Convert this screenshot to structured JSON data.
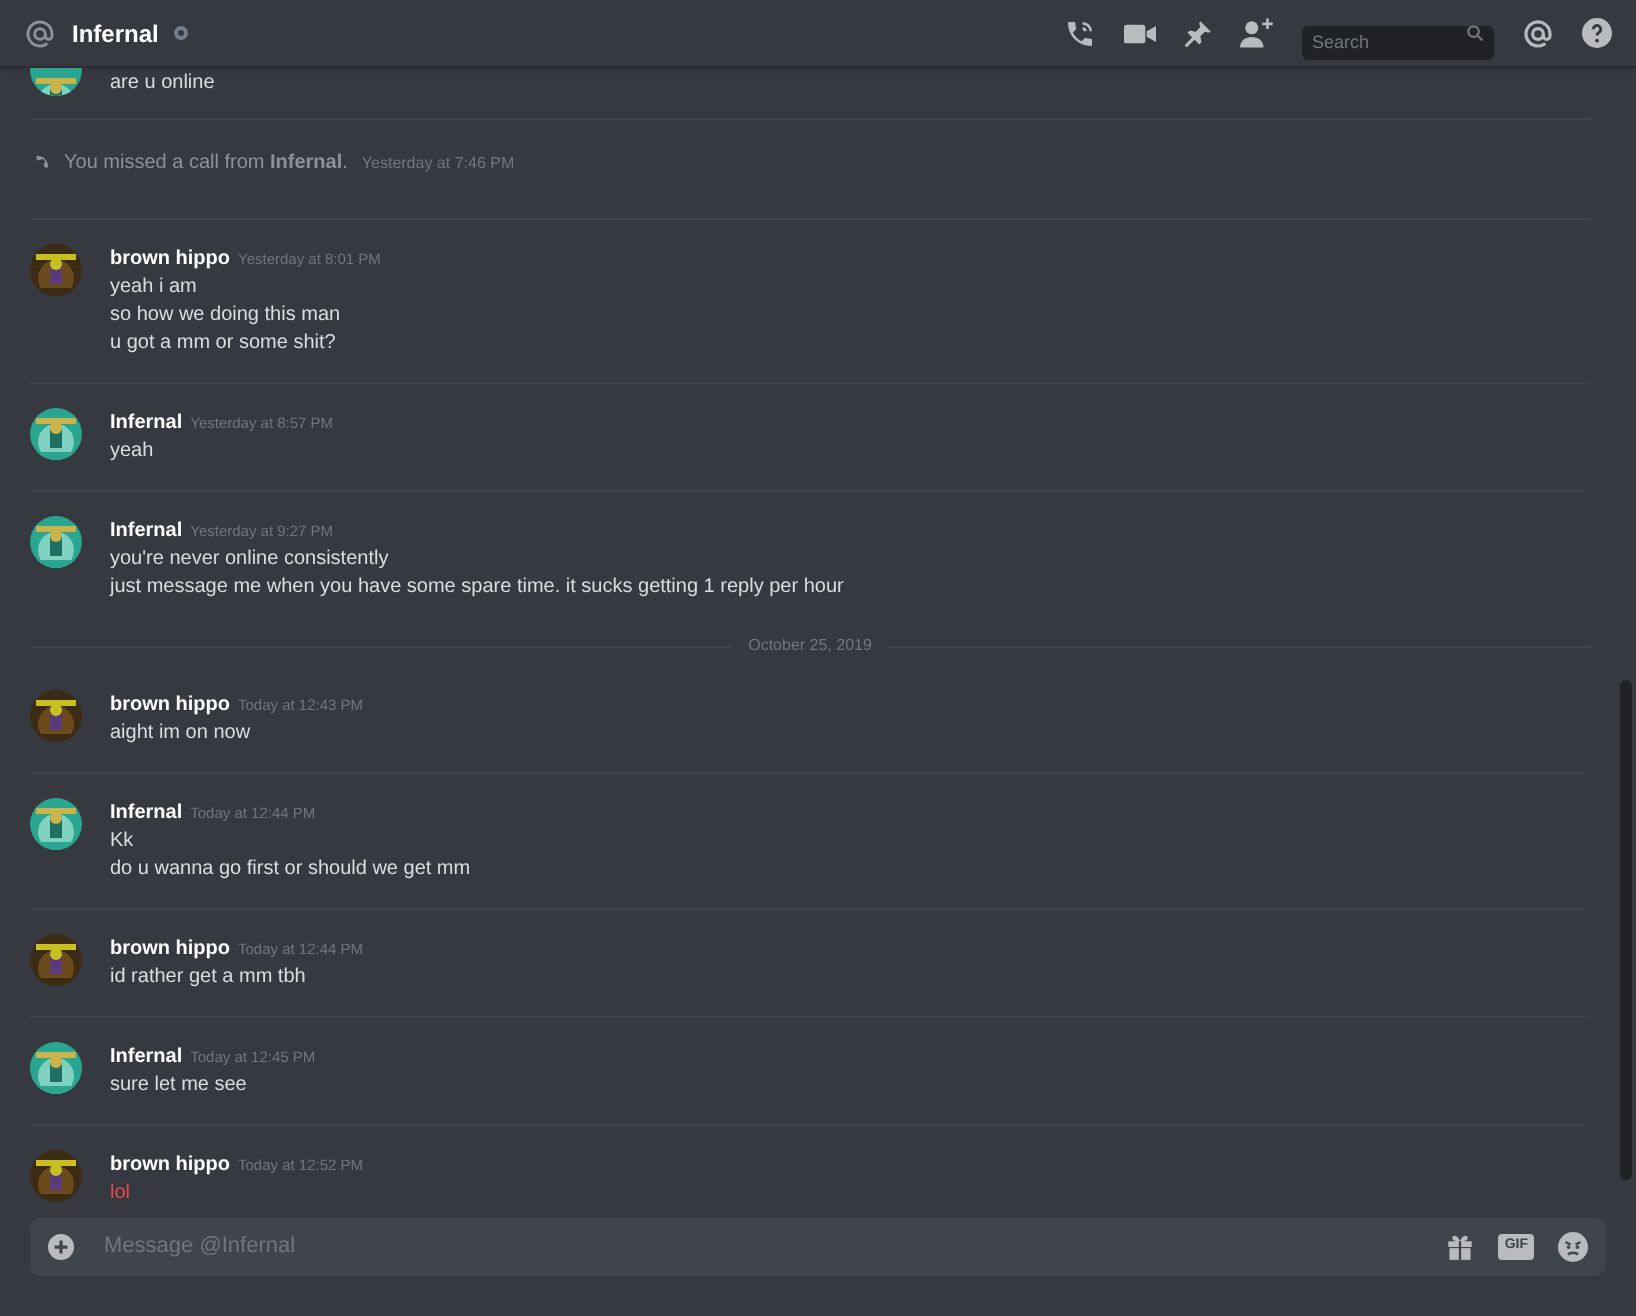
{
  "header": {
    "name": "Infernal",
    "online": false,
    "search": {
      "placeholder": "Search"
    }
  },
  "feed": [
    {
      "kind": "tail",
      "avatar": {
        "kind": "picture",
        "color": "#2aa58f"
      },
      "lines": [
        {
          "text": "are u online"
        }
      ]
    },
    {
      "kind": "call",
      "text": "You missed a call from **Infernal**.",
      "time": "Yesterday at 7:46 PM"
    },
    {
      "kind": "message",
      "author": "brown hippo",
      "avatar": {
        "kind": "picture",
        "color": "#3b2a14"
      },
      "time": "Yesterday at 8:01 PM",
      "lines": [
        {
          "text": "yeah i am"
        },
        {
          "text": "so how we doing this man"
        },
        {
          "text": "u got a mm or some shit?"
        }
      ]
    },
    {
      "kind": "message",
      "author": "Infernal",
      "avatar": {
        "kind": "picture",
        "color": "#2aa58f"
      },
      "time": "Yesterday at 8:57 PM",
      "lines": [
        {
          "text": "yeah"
        }
      ]
    },
    {
      "kind": "message",
      "author": "Infernal",
      "avatar": {
        "kind": "picture",
        "color": "#2aa58f"
      },
      "time": "Yesterday at 9:27 PM",
      "lines": [
        {
          "text": "you're never online consistently"
        },
        {
          "text": "just message me when you have some spare time. it sucks getting 1 reply per hour"
        }
      ]
    },
    {
      "kind": "date",
      "text": "October 25, 2019"
    },
    {
      "kind": "message",
      "author": "brown hippo",
      "avatar": {
        "kind": "picture",
        "color": "#3b2a14"
      },
      "time": "Today at 12:43 PM",
      "lines": [
        {
          "text": "aight im on now"
        }
      ]
    },
    {
      "kind": "message",
      "author": "Infernal",
      "avatar": {
        "kind": "picture",
        "color": "#2aa58f"
      },
      "time": "Today at 12:44 PM",
      "lines": [
        {
          "text": "Kk"
        },
        {
          "text": "do u wanna go first or should we get mm"
        }
      ]
    },
    {
      "kind": "message",
      "author": "brown hippo",
      "avatar": {
        "kind": "picture",
        "color": "#3b2a14"
      },
      "time": "Today at 12:44 PM",
      "lines": [
        {
          "text": "id rather get a mm tbh"
        }
      ]
    },
    {
      "kind": "message",
      "author": "Infernal",
      "avatar": {
        "kind": "picture",
        "color": "#2aa58f"
      },
      "time": "Today at 12:45 PM",
      "lines": [
        {
          "text": "sure let me see"
        }
      ]
    },
    {
      "kind": "message",
      "author": "brown hippo",
      "avatar": {
        "kind": "picture",
        "color": "#3b2a14"
      },
      "time": "Today at 12:52 PM",
      "lines": [
        {
          "text": "lol",
          "color": "#f04747"
        }
      ]
    }
  ],
  "composer": {
    "placeholder": "Message @Infernal",
    "gif": "GIF"
  }
}
